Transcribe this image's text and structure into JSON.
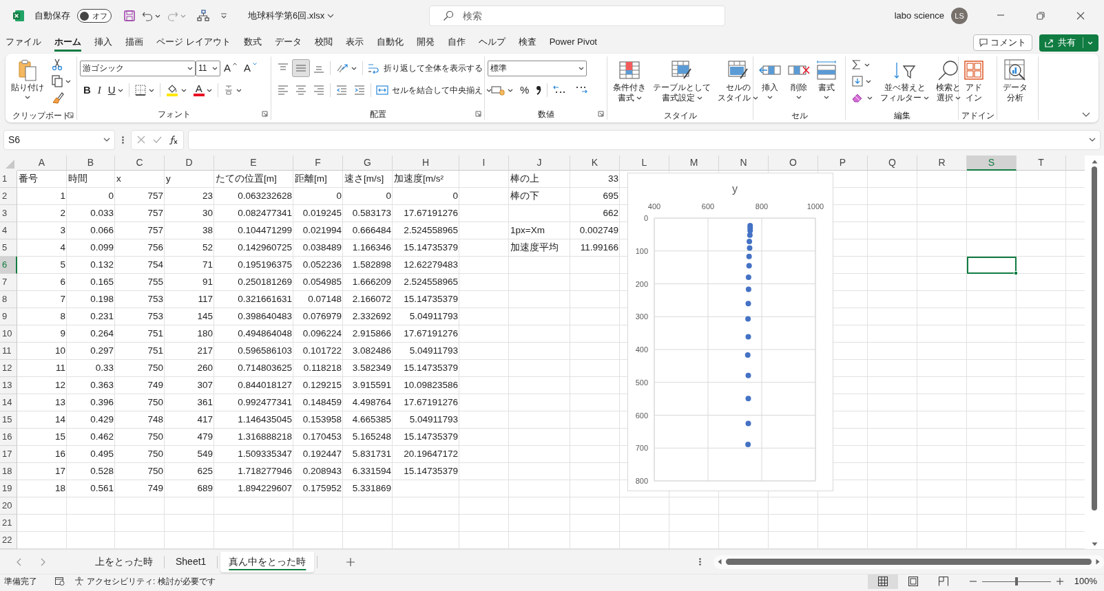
{
  "title_bar": {
    "autosave_label": "自動保存",
    "autosave": {
      "on": false,
      "label": "オフ"
    },
    "file_name": "地球科学第6回.xlsx",
    "search_placeholder": "検索",
    "user_name": "labo science",
    "avatar_initials": "LS"
  },
  "menu_tabs": [
    {
      "label": "ファイル",
      "selected": false
    },
    {
      "label": "ホーム",
      "selected": true
    },
    {
      "label": "挿入",
      "selected": false
    },
    {
      "label": "描画",
      "selected": false
    },
    {
      "label": "ページ レイアウト",
      "selected": false
    },
    {
      "label": "数式",
      "selected": false
    },
    {
      "label": "データ",
      "selected": false
    },
    {
      "label": "校閲",
      "selected": false
    },
    {
      "label": "表示",
      "selected": false
    },
    {
      "label": "自動化",
      "selected": false
    },
    {
      "label": "開発",
      "selected": false
    },
    {
      "label": "自作",
      "selected": false
    },
    {
      "label": "ヘルプ",
      "selected": false
    },
    {
      "label": "検査",
      "selected": false
    },
    {
      "label": "Power Pivot",
      "selected": false
    }
  ],
  "comment_button": "コメント",
  "share_button": "共有",
  "ribbon": [
    {
      "label": "クリップボード",
      "dialog": true,
      "items": [
        {
          "kind": "large",
          "label": "貼り付け",
          "dropdown": true
        },
        {
          "kind": "stack",
          "rows": [
            {
              "controls": [
                {
                  "kind": "icon"
                }
              ]
            },
            {
              "controls": [
                {
                  "kind": "icon",
                  "dropdown": true
                }
              ]
            },
            {
              "controls": [
                {
                  "kind": "icon"
                }
              ]
            }
          ]
        }
      ]
    },
    {
      "label": "フォント",
      "dialog": true,
      "items": [
        {
          "kind": "stack",
          "rows": [
            {
              "controls": [
                {
                  "kind": "combo",
                  "label": "游ゴシック"
                },
                {
                  "kind": "combo",
                  "label": "11"
                },
                {
                  "kind": "glyph",
                  "label": "A"
                },
                {
                  "kind": "glyph",
                  "label": "A"
                }
              ]
            },
            {
              "controls": [
                {
                  "kind": "glyph",
                  "label": "B"
                },
                {
                  "kind": "glyph",
                  "label": "I"
                },
                {
                  "kind": "glyph",
                  "label": "U",
                  "dropdown": true
                },
                {
                  "kind": "separator"
                },
                {
                  "kind": "icon",
                  "dropdown": true
                },
                {
                  "kind": "separator"
                },
                {
                  "kind": "icon",
                  "dropdown": true
                },
                {
                  "kind": "glyph-bar",
                  "label": "A",
                  "dropdown": true
                },
                {
                  "kind": "separator"
                },
                {
                  "kind": "icon",
                  "dropdown": true
                }
              ]
            }
          ]
        }
      ]
    },
    {
      "label": "配置",
      "dialog": true,
      "items": [
        {
          "kind": "stack",
          "rows": [
            {
              "controls": [
                {
                  "kind": "icon",
                  "selected": false
                },
                {
                  "kind": "icon",
                  "selected": true
                },
                {
                  "kind": "icon",
                  "selected": false
                },
                {
                  "kind": "separator"
                },
                {
                  "kind": "icon",
                  "dropdown": true
                },
                {
                  "kind": "separator"
                },
                {
                  "kind": "text",
                  "label": "折り返して全体を表示する"
                }
              ]
            },
            {
              "controls": [
                {
                  "kind": "icon",
                  "selected": false
                },
                {
                  "kind": "icon",
                  "selected": false
                },
                {
                  "kind": "icon",
                  "selected": false
                },
                {
                  "kind": "separator"
                },
                {
                  "kind": "icon"
                },
                {
                  "kind": "icon"
                },
                {
                  "kind": "separator"
                },
                {
                  "kind": "text",
                  "label": "セルを結合して中央揃え",
                  "dropdown": true
                }
              ]
            }
          ]
        }
      ]
    },
    {
      "label": "数値",
      "dialog": true,
      "items": [
        {
          "kind": "stack",
          "rows": [
            {
              "controls": [
                {
                  "kind": "combo",
                  "label": "標準"
                }
              ]
            },
            {
              "controls": [
                {
                  "kind": "icon",
                  "dropdown": true
                },
                {
                  "kind": "glyph",
                  "label": "%"
                },
                {
                  "kind": "icon"
                },
                {
                  "kind": "separator"
                },
                {
                  "kind": "icon"
                },
                {
                  "kind": "icon"
                }
              ]
            }
          ]
        }
      ]
    },
    {
      "label": "スタイル",
      "items": [
        {
          "kind": "large",
          "lines": [
            "条件付き",
            "書式"
          ],
          "dropdown": true
        },
        {
          "kind": "large",
          "lines": [
            "テーブルとして",
            "書式設定"
          ],
          "dropdown": true
        },
        {
          "kind": "large",
          "lines": [
            "セルの",
            "スタイル"
          ],
          "dropdown": true
        }
      ]
    },
    {
      "label": "セル",
      "items": [
        {
          "kind": "large",
          "label": "挿入",
          "dropdown": true
        },
        {
          "kind": "large",
          "label": "削除",
          "dropdown": true
        },
        {
          "kind": "large",
          "label": "書式",
          "dropdown": true
        }
      ]
    },
    {
      "label": "編集",
      "items": [
        {
          "kind": "stack",
          "rows": [
            {
              "controls": [
                {
                  "kind": "icon",
                  "dropdown": true
                }
              ]
            },
            {
              "controls": [
                {
                  "kind": "icon",
                  "dropdown": true
                }
              ]
            },
            {
              "controls": [
                {
                  "kind": "icon",
                  "dropdown": true
                }
              ]
            }
          ]
        },
        {
          "kind": "large",
          "lines": [
            "並べ替えと",
            "フィルター"
          ],
          "dropdown": true
        },
        {
          "kind": "large",
          "lines": [
            "検索と",
            "選択"
          ],
          "dropdown": true
        }
      ]
    },
    {
      "label": "アドイン",
      "items": [
        {
          "kind": "large",
          "lines": [
            "アド",
            "イン"
          ]
        }
      ]
    },
    {
      "items": [
        {
          "kind": "large",
          "lines": [
            "データ",
            "分析"
          ]
        }
      ]
    }
  ],
  "formula_bar": {
    "name_box": "S6"
  },
  "grid": {
    "columns": [
      {
        "label": "A",
        "selected": false
      },
      {
        "label": "B",
        "selected": false
      },
      {
        "label": "C",
        "selected": false
      },
      {
        "label": "D",
        "selected": false
      },
      {
        "label": "E",
        "selected": false
      },
      {
        "label": "F",
        "selected": false
      },
      {
        "label": "G",
        "selected": false
      },
      {
        "label": "H",
        "selected": false
      },
      {
        "label": "I",
        "selected": false
      },
      {
        "label": "J",
        "selected": false
      },
      {
        "label": "K",
        "selected": false
      },
      {
        "label": "L",
        "selected": false
      },
      {
        "label": "M",
        "selected": false
      },
      {
        "label": "N",
        "selected": false
      },
      {
        "label": "O",
        "selected": false
      },
      {
        "label": "P",
        "selected": false
      },
      {
        "label": "Q",
        "selected": false
      },
      {
        "label": "R",
        "selected": false
      },
      {
        "label": "S",
        "selected": true
      },
      {
        "label": "T",
        "selected": false
      }
    ],
    "rows": [
      {
        "label": "1",
        "selected": false,
        "cells": [
          {
            "value": "番号",
            "kind": "text"
          },
          {
            "value": "時間",
            "kind": "text"
          },
          {
            "value": "x",
            "kind": "text"
          },
          {
            "value": "y",
            "kind": "text"
          },
          {
            "value": "たての位置[m]",
            "kind": "text"
          },
          {
            "value": "距離[m]",
            "kind": "text"
          },
          {
            "value": "速さ[m/s]",
            "kind": "text"
          },
          {
            "value": "加速度[m/s²",
            "kind": "text"
          },
          null,
          {
            "value": "棒の上",
            "kind": "text"
          },
          {
            "value": "33",
            "kind": "number"
          }
        ]
      },
      {
        "label": "2",
        "selected": false,
        "cells": [
          {
            "value": "1",
            "kind": "number"
          },
          {
            "value": "0",
            "kind": "number"
          },
          {
            "value": "757",
            "kind": "number"
          },
          {
            "value": "23",
            "kind": "number"
          },
          {
            "value": "0.063232628",
            "kind": "number"
          },
          {
            "value": "0",
            "kind": "number"
          },
          {
            "value": "0",
            "kind": "number"
          },
          {
            "value": "0",
            "kind": "number"
          },
          null,
          {
            "value": "棒の下",
            "kind": "text"
          },
          {
            "value": "695",
            "kind": "number"
          }
        ]
      },
      {
        "label": "3",
        "selected": false,
        "cells": [
          {
            "value": "2",
            "kind": "number"
          },
          {
            "value": "0.033",
            "kind": "number"
          },
          {
            "value": "757",
            "kind": "number"
          },
          {
            "value": "30",
            "kind": "number"
          },
          {
            "value": "0.082477341",
            "kind": "number"
          },
          {
            "value": "0.019245",
            "kind": "number"
          },
          {
            "value": "0.583173",
            "kind": "number"
          },
          {
            "value": "17.67191276",
            "kind": "number"
          },
          null,
          null,
          {
            "value": "662",
            "kind": "number"
          }
        ]
      },
      {
        "label": "4",
        "selected": false,
        "cells": [
          {
            "value": "3",
            "kind": "number"
          },
          {
            "value": "0.066",
            "kind": "number"
          },
          {
            "value": "757",
            "kind": "number"
          },
          {
            "value": "38",
            "kind": "number"
          },
          {
            "value": "0.104471299",
            "kind": "number"
          },
          {
            "value": "0.021994",
            "kind": "number"
          },
          {
            "value": "0.666484",
            "kind": "number"
          },
          {
            "value": "2.524558965",
            "kind": "number"
          },
          null,
          {
            "value": "1px=Xm",
            "kind": "text"
          },
          {
            "value": "0.002749",
            "kind": "number"
          }
        ]
      },
      {
        "label": "5",
        "selected": false,
        "cells": [
          {
            "value": "4",
            "kind": "number"
          },
          {
            "value": "0.099",
            "kind": "number"
          },
          {
            "value": "756",
            "kind": "number"
          },
          {
            "value": "52",
            "kind": "number"
          },
          {
            "value": "0.142960725",
            "kind": "number"
          },
          {
            "value": "0.038489",
            "kind": "number"
          },
          {
            "value": "1.166346",
            "kind": "number"
          },
          {
            "value": "15.14735379",
            "kind": "number"
          },
          null,
          {
            "value": "加速度平均",
            "kind": "text"
          },
          {
            "value": "11.99166",
            "kind": "number"
          }
        ]
      },
      {
        "label": "6",
        "selected": true,
        "cells": [
          {
            "value": "5",
            "kind": "number"
          },
          {
            "value": "0.132",
            "kind": "number"
          },
          {
            "value": "754",
            "kind": "number"
          },
          {
            "value": "71",
            "kind": "number"
          },
          {
            "value": "0.195196375",
            "kind": "number"
          },
          {
            "value": "0.052236",
            "kind": "number"
          },
          {
            "value": "1.582898",
            "kind": "number"
          },
          {
            "value": "12.62279483",
            "kind": "number"
          }
        ]
      },
      {
        "label": "7",
        "selected": false,
        "cells": [
          {
            "value": "6",
            "kind": "number"
          },
          {
            "value": "0.165",
            "kind": "number"
          },
          {
            "value": "755",
            "kind": "number"
          },
          {
            "value": "91",
            "kind": "number"
          },
          {
            "value": "0.250181269",
            "kind": "number"
          },
          {
            "value": "0.054985",
            "kind": "number"
          },
          {
            "value": "1.666209",
            "kind": "number"
          },
          {
            "value": "2.524558965",
            "kind": "number"
          }
        ]
      },
      {
        "label": "8",
        "selected": false,
        "cells": [
          {
            "value": "7",
            "kind": "number"
          },
          {
            "value": "0.198",
            "kind": "number"
          },
          {
            "value": "753",
            "kind": "number"
          },
          {
            "value": "117",
            "kind": "number"
          },
          {
            "value": "0.321661631",
            "kind": "number"
          },
          {
            "value": "0.07148",
            "kind": "number"
          },
          {
            "value": "2.166072",
            "kind": "number"
          },
          {
            "value": "15.14735379",
            "kind": "number"
          }
        ]
      },
      {
        "label": "9",
        "selected": false,
        "cells": [
          {
            "value": "8",
            "kind": "number"
          },
          {
            "value": "0.231",
            "kind": "number"
          },
          {
            "value": "753",
            "kind": "number"
          },
          {
            "value": "145",
            "kind": "number"
          },
          {
            "value": "0.398640483",
            "kind": "number"
          },
          {
            "value": "0.076979",
            "kind": "number"
          },
          {
            "value": "2.332692",
            "kind": "number"
          },
          {
            "value": "5.04911793",
            "kind": "number"
          }
        ]
      },
      {
        "label": "10",
        "selected": false,
        "cells": [
          {
            "value": "9",
            "kind": "number"
          },
          {
            "value": "0.264",
            "kind": "number"
          },
          {
            "value": "751",
            "kind": "number"
          },
          {
            "value": "180",
            "kind": "number"
          },
          {
            "value": "0.494864048",
            "kind": "number"
          },
          {
            "value": "0.096224",
            "kind": "number"
          },
          {
            "value": "2.915866",
            "kind": "number"
          },
          {
            "value": "17.67191276",
            "kind": "number"
          }
        ]
      },
      {
        "label": "11",
        "selected": false,
        "cells": [
          {
            "value": "10",
            "kind": "number"
          },
          {
            "value": "0.297",
            "kind": "number"
          },
          {
            "value": "751",
            "kind": "number"
          },
          {
            "value": "217",
            "kind": "number"
          },
          {
            "value": "0.596586103",
            "kind": "number"
          },
          {
            "value": "0.101722",
            "kind": "number"
          },
          {
            "value": "3.082486",
            "kind": "number"
          },
          {
            "value": "5.04911793",
            "kind": "number"
          }
        ]
      },
      {
        "label": "12",
        "selected": false,
        "cells": [
          {
            "value": "11",
            "kind": "number"
          },
          {
            "value": "0.33",
            "kind": "number"
          },
          {
            "value": "750",
            "kind": "number"
          },
          {
            "value": "260",
            "kind": "number"
          },
          {
            "value": "0.714803625",
            "kind": "number"
          },
          {
            "value": "0.118218",
            "kind": "number"
          },
          {
            "value": "3.582349",
            "kind": "number"
          },
          {
            "value": "15.14735379",
            "kind": "number"
          }
        ]
      },
      {
        "label": "13",
        "selected": false,
        "cells": [
          {
            "value": "12",
            "kind": "number"
          },
          {
            "value": "0.363",
            "kind": "number"
          },
          {
            "value": "749",
            "kind": "number"
          },
          {
            "value": "307",
            "kind": "number"
          },
          {
            "value": "0.844018127",
            "kind": "number"
          },
          {
            "value": "0.129215",
            "kind": "number"
          },
          {
            "value": "3.915591",
            "kind": "number"
          },
          {
            "value": "10.09823586",
            "kind": "number"
          }
        ]
      },
      {
        "label": "14",
        "selected": false,
        "cells": [
          {
            "value": "13",
            "kind": "number"
          },
          {
            "value": "0.396",
            "kind": "number"
          },
          {
            "value": "750",
            "kind": "number"
          },
          {
            "value": "361",
            "kind": "number"
          },
          {
            "value": "0.992477341",
            "kind": "number"
          },
          {
            "value": "0.148459",
            "kind": "number"
          },
          {
            "value": "4.498764",
            "kind": "number"
          },
          {
            "value": "17.67191276",
            "kind": "number"
          }
        ]
      },
      {
        "label": "15",
        "selected": false,
        "cells": [
          {
            "value": "14",
            "kind": "number"
          },
          {
            "value": "0.429",
            "kind": "number"
          },
          {
            "value": "748",
            "kind": "number"
          },
          {
            "value": "417",
            "kind": "number"
          },
          {
            "value": "1.146435045",
            "kind": "number"
          },
          {
            "value": "0.153958",
            "kind": "number"
          },
          {
            "value": "4.665385",
            "kind": "number"
          },
          {
            "value": "5.04911793",
            "kind": "number"
          }
        ]
      },
      {
        "label": "16",
        "selected": false,
        "cells": [
          {
            "value": "15",
            "kind": "number"
          },
          {
            "value": "0.462",
            "kind": "number"
          },
          {
            "value": "750",
            "kind": "number"
          },
          {
            "value": "479",
            "kind": "number"
          },
          {
            "value": "1.316888218",
            "kind": "number"
          },
          {
            "value": "0.170453",
            "kind": "number"
          },
          {
            "value": "5.165248",
            "kind": "number"
          },
          {
            "value": "15.14735379",
            "kind": "number"
          }
        ]
      },
      {
        "label": "17",
        "selected": false,
        "cells": [
          {
            "value": "16",
            "kind": "number"
          },
          {
            "value": "0.495",
            "kind": "number"
          },
          {
            "value": "750",
            "kind": "number"
          },
          {
            "value": "549",
            "kind": "number"
          },
          {
            "value": "1.509335347",
            "kind": "number"
          },
          {
            "value": "0.192447",
            "kind": "number"
          },
          {
            "value": "5.831731",
            "kind": "number"
          },
          {
            "value": "20.19647172",
            "kind": "number"
          }
        ]
      },
      {
        "label": "18",
        "selected": false,
        "cells": [
          {
            "value": "17",
            "kind": "number"
          },
          {
            "value": "0.528",
            "kind": "number"
          },
          {
            "value": "750",
            "kind": "number"
          },
          {
            "value": "625",
            "kind": "number"
          },
          {
            "value": "1.718277946",
            "kind": "number"
          },
          {
            "value": "0.208943",
            "kind": "number"
          },
          {
            "value": "6.331594",
            "kind": "number"
          },
          {
            "value": "15.14735379",
            "kind": "number"
          }
        ]
      },
      {
        "label": "19",
        "selected": false,
        "cells": [
          {
            "value": "18",
            "kind": "number"
          },
          {
            "value": "0.561",
            "kind": "number"
          },
          {
            "value": "749",
            "kind": "number"
          },
          {
            "value": "689",
            "kind": "number"
          },
          {
            "value": "1.894229607",
            "kind": "number"
          },
          {
            "value": "0.175952",
            "kind": "number"
          },
          {
            "value": "5.331869",
            "kind": "number"
          }
        ]
      },
      {
        "label": "20",
        "selected": false
      },
      {
        "label": "21",
        "selected": false
      },
      {
        "label": "22",
        "selected": false
      }
    ],
    "chart": {
      "chart_data": {
        "type": "scatter",
        "title": "y",
        "x": [
          757,
          757,
          757,
          756,
          754,
          755,
          753,
          753,
          751,
          751,
          750,
          749,
          750,
          748,
          750,
          750,
          750,
          749
        ],
        "series": [
          {
            "color": "#4472c4",
            "values": [
              23,
              30,
              38,
              52,
              71,
              91,
              117,
              145,
              180,
              217,
              260,
              307,
              361,
              417,
              479,
              549,
              625,
              689
            ]
          }
        ],
        "xlim": [
          400,
          1000
        ],
        "ylim": [
          800,
          0
        ],
        "grid": true,
        "xticks": [
          400,
          600,
          800,
          1000
        ],
        "yticks": [
          0,
          100,
          200,
          300,
          400,
          500,
          600,
          700,
          800
        ]
      }
    }
  },
  "sheet_tabs": [
    {
      "label": "上をとった時",
      "selected": false
    },
    {
      "label": "Sheet1",
      "selected": false
    },
    {
      "label": "真ん中をとった時",
      "selected": true
    }
  ],
  "status_bar": {
    "ready": "準備完了",
    "accessibility": "アクセシビリティ: 検討が必要です",
    "views": [
      {
        "selected": true
      },
      {
        "selected": false
      },
      {
        "selected": false
      }
    ],
    "zoom": {
      "level": 0.5,
      "label": "100%"
    }
  }
}
